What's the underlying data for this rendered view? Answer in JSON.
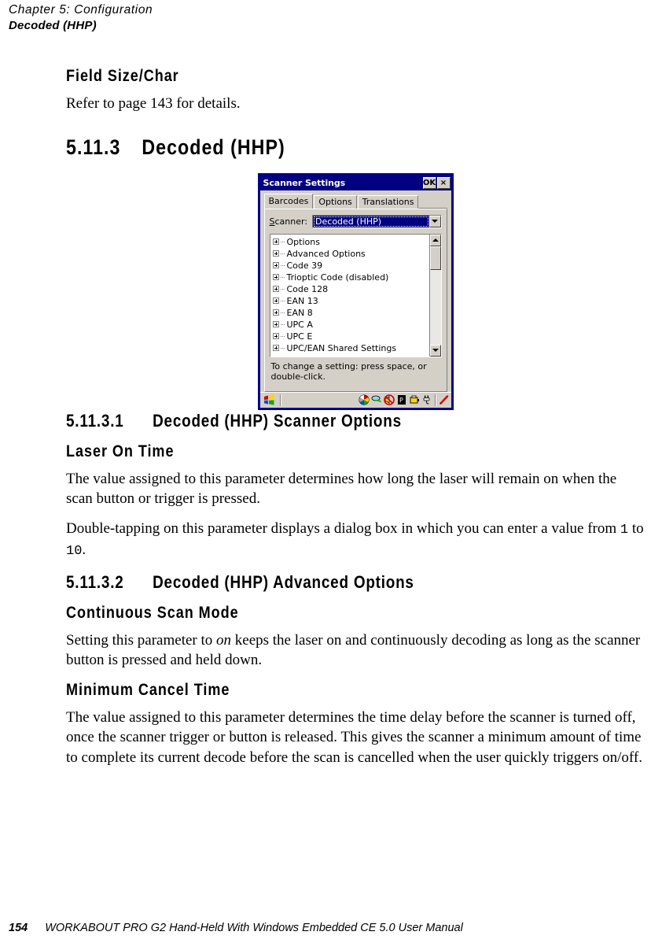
{
  "header": {
    "chapter": "Chapter 5: Configuration",
    "section": "Decoded (HHP)"
  },
  "content": {
    "field_size_heading": "Field Size/Char",
    "field_size_body": "Refer to page 143 for details.",
    "section_5113_num": "5.11.3",
    "section_5113_title": "Decoded (HHP)",
    "section_51131_num": "5.11.3.1",
    "section_51131_title": "Decoded (HHP) Scanner Options",
    "laser_on_time_heading": "Laser On Time",
    "laser_on_time_p1": "The value assigned to this parameter determines how long the laser will remain on when the scan button or trigger is pressed.",
    "laser_on_time_p2_a": "Double-tapping on this parameter displays a dialog box in which you can enter a value from ",
    "laser_on_time_min": "1",
    "laser_on_time_p2_b": " to ",
    "laser_on_time_max": "10",
    "laser_on_time_p2_c": ".",
    "section_51132_num": "5.11.3.2",
    "section_51132_title": "Decoded (HHP) Advanced Options",
    "continuous_scan_heading": "Continuous Scan Mode",
    "continuous_scan_p1_a": "Setting this parameter to ",
    "continuous_scan_p1_em": "on",
    "continuous_scan_p1_b": " keeps the laser on and continuously decoding as long as the scanner button is pressed and held down.",
    "minimum_cancel_heading": "Minimum Cancel Time",
    "minimum_cancel_p1": "The value assigned to this parameter determines the time delay before the scanner is turned off, once the scanner trigger or button is released. This gives the scanner a minimum amount of time to complete its current decode before the scan is cancelled when the user quickly triggers on/off."
  },
  "dialog": {
    "title": "Scanner Settings",
    "ok_label": "OK",
    "close_label": "×",
    "tabs": [
      {
        "label": "Barcodes",
        "active": true
      },
      {
        "label": "Options",
        "active": false
      },
      {
        "label": "Translations",
        "active": false
      }
    ],
    "scanner_label_accel": "S",
    "scanner_label_rest": "canner:",
    "scanner_value": "Decoded (HHP)",
    "tree_items": [
      "Options",
      "Advanced Options",
      "Code 39",
      "Trioptic Code (disabled)",
      "Code 128",
      "EAN 13",
      "EAN 8",
      "UPC A",
      "UPC E",
      "UPC/EAN Shared Settings"
    ],
    "hint_line1": "To change a setting: press space, or",
    "hint_line2": "double-click.",
    "tray_icons": [
      "display-properties-icon",
      "network-connection-icon",
      "volume-muted-icon",
      "power-profile-icon",
      "battery-icon",
      "ac-power-icon"
    ],
    "pen_icon": "stylus-pen-icon",
    "start_icon": "windows-start-icon",
    "colors": {
      "titlebar": "#000080",
      "window_border": "#00008b",
      "face": "#d4d0c8",
      "selection": "#000080"
    }
  },
  "footer": {
    "page_number": "154",
    "manual_title": "WORKABOUT PRO G2 Hand-Held With Windows Embedded CE 5.0 User Manual"
  }
}
